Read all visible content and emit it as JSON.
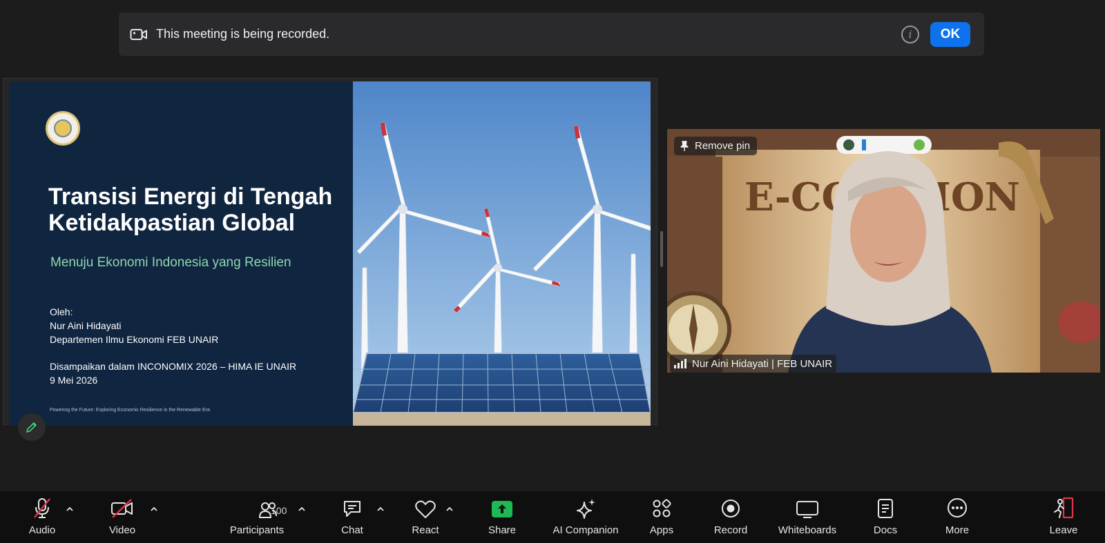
{
  "banner": {
    "message": "This meeting is being recorded.",
    "ok_label": "OK"
  },
  "slide": {
    "title": "Transisi Energi di Tengah Ketidakpastian Global",
    "subtitle": "Menuju Ekonomi Indonesia yang Resilien",
    "by_label": "Oleh:",
    "author": "Nur Aini Hidayati",
    "department": "Departemen Ilmu Ekonomi FEB UNAIR",
    "event": "Disampaikan dalam INCONOMIX 2026 – HIMA IE UNAIR",
    "date": "9 Mei 2026",
    "footer": "Powering the Future: Exploring Economic Resilience in the Renewable Era"
  },
  "video": {
    "pin_label": "Remove pin",
    "participant_name": "Nur Aini Hidayati | FEB UNAIR",
    "background_text": "E-CON    TION"
  },
  "toolbar": {
    "audio": "Audio",
    "video": "Video",
    "participants": "Participants",
    "participant_count": "100",
    "chat": "Chat",
    "react": "React",
    "share": "Share",
    "ai_companion": "AI Companion",
    "apps": "Apps",
    "record": "Record",
    "whiteboards": "Whiteboards",
    "docs": "Docs",
    "more": "More",
    "leave": "Leave"
  },
  "colors": {
    "ok_button": "#0e72ed",
    "share_green": "#1db954",
    "muted_red": "#e0344a",
    "subtitle_green": "#8fd6b0"
  }
}
